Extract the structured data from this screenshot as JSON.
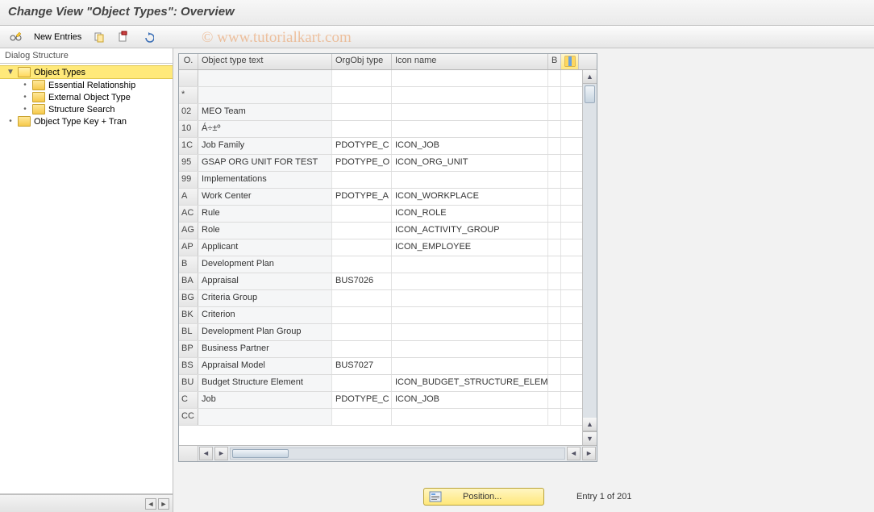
{
  "title": "Change View \"Object Types\": Overview",
  "watermark": "© www.tutorialkart.com",
  "toolbar": {
    "new_entries_label": "New Entries"
  },
  "sidebar": {
    "heading": "Dialog Structure",
    "nodes": [
      {
        "label": "Object Types",
        "open": true,
        "selected": true,
        "level": 0,
        "children": [
          {
            "label": "Essential Relationship",
            "level": 1
          },
          {
            "label": "External Object Type",
            "level": 1
          },
          {
            "label": "Structure Search",
            "level": 1
          }
        ]
      },
      {
        "label": "Object Type Key + Tran",
        "open": false,
        "selected": false,
        "level": 0
      }
    ]
  },
  "grid": {
    "columns": {
      "key": "O.",
      "text": "Object type text",
      "org": "OrgObj type",
      "icon": "Icon name",
      "b": "B"
    },
    "rows": [
      {
        "key": "",
        "text": "",
        "org": "",
        "icon": ""
      },
      {
        "key": "*",
        "text": "",
        "org": "",
        "icon": ""
      },
      {
        "key": "02",
        "text": "MEO Team",
        "org": "",
        "icon": ""
      },
      {
        "key": "10",
        "text": "Á÷±º",
        "org": "",
        "icon": ""
      },
      {
        "key": "1C",
        "text": "Job Family",
        "org": "PDOTYPE_C",
        "icon": "ICON_JOB"
      },
      {
        "key": "95",
        "text": "GSAP ORG UNIT FOR TEST",
        "org": "PDOTYPE_O",
        "icon": "ICON_ORG_UNIT"
      },
      {
        "key": "99",
        "text": "Implementations",
        "org": "",
        "icon": ""
      },
      {
        "key": "A",
        "text": "Work Center",
        "org": "PDOTYPE_A",
        "icon": "ICON_WORKPLACE"
      },
      {
        "key": "AC",
        "text": "Rule",
        "org": "",
        "icon": "ICON_ROLE"
      },
      {
        "key": "AG",
        "text": "Role",
        "org": "",
        "icon": "ICON_ACTIVITY_GROUP"
      },
      {
        "key": "AP",
        "text": "Applicant",
        "org": "",
        "icon": "ICON_EMPLOYEE"
      },
      {
        "key": "B",
        "text": "Development Plan",
        "org": "",
        "icon": ""
      },
      {
        "key": "BA",
        "text": "Appraisal",
        "org": "BUS7026",
        "icon": ""
      },
      {
        "key": "BG",
        "text": "Criteria Group",
        "org": "",
        "icon": ""
      },
      {
        "key": "BK",
        "text": "Criterion",
        "org": "",
        "icon": ""
      },
      {
        "key": "BL",
        "text": "Development Plan Group",
        "org": "",
        "icon": ""
      },
      {
        "key": "BP",
        "text": "Business Partner",
        "org": "",
        "icon": ""
      },
      {
        "key": "BS",
        "text": "Appraisal Model",
        "org": "BUS7027",
        "icon": ""
      },
      {
        "key": "BU",
        "text": "Budget Structure Element",
        "org": "",
        "icon": "ICON_BUDGET_STRUCTURE_ELEMENT"
      },
      {
        "key": "C",
        "text": "Job",
        "org": "PDOTYPE_C",
        "icon": "ICON_JOB"
      },
      {
        "key": "CC",
        "text": "",
        "org": "",
        "icon": ""
      }
    ]
  },
  "footer": {
    "position_label": "Position...",
    "entry_label": "Entry 1 of 201"
  }
}
